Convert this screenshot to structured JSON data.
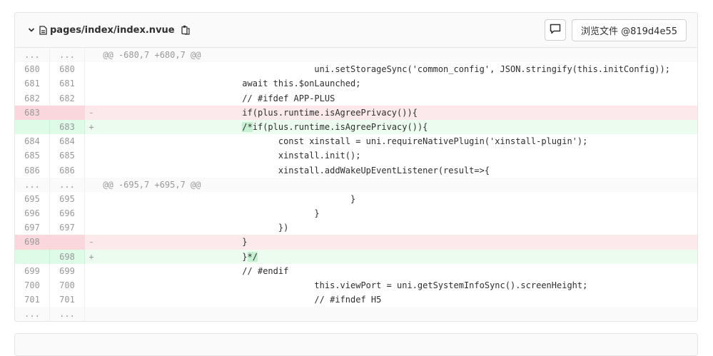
{
  "file": {
    "path": "pages/index/index.nvue",
    "view_file_label": "浏览文件 @819d4e55"
  },
  "lines": [
    {
      "type": "match",
      "old": "...",
      "new": "...",
      "sign": "",
      "code": "@@ -680,7 +680,7 @@"
    },
    {
      "type": "context",
      "old": "680",
      "new": "680",
      "sign": "",
      "code": "\t\t\t\t\t\tuni.setStorageSync('common_config', JSON.stringify(this.initConfig));"
    },
    {
      "type": "context",
      "old": "681",
      "new": "681",
      "sign": "",
      "code": "\t\t\t\tawait this.$onLaunched;"
    },
    {
      "type": "context",
      "old": "682",
      "new": "682",
      "sign": "",
      "code": "\t\t\t\t// #ifdef APP-PLUS"
    },
    {
      "type": "old",
      "old": "683",
      "new": "",
      "sign": "-",
      "code": "\t\t\t\tif(plus.runtime.isAgreePrivacy()){"
    },
    {
      "type": "new",
      "old": "",
      "new": "683",
      "sign": "+",
      "code_hl": "/*",
      "code_rest": "if(plus.runtime.isAgreePrivacy()){",
      "code": "\t\t\t\t"
    },
    {
      "type": "context",
      "old": "684",
      "new": "684",
      "sign": "",
      "code": "\t\t\t\t\tconst xinstall = uni.requireNativePlugin('xinstall-plugin');"
    },
    {
      "type": "context",
      "old": "685",
      "new": "685",
      "sign": "",
      "code": "\t\t\t\t\txinstall.init();"
    },
    {
      "type": "context",
      "old": "686",
      "new": "686",
      "sign": "",
      "code": "\t\t\t\t\txinstall.addWakeUpEventListener(result=>{"
    },
    {
      "type": "match",
      "old": "...",
      "new": "...",
      "sign": "",
      "code": "@@ -695,7 +695,7 @@"
    },
    {
      "type": "context",
      "old": "695",
      "new": "695",
      "sign": "",
      "code": "\t\t\t\t\t\t\t}"
    },
    {
      "type": "context",
      "old": "696",
      "new": "696",
      "sign": "",
      "code": "\t\t\t\t\t\t}"
    },
    {
      "type": "context",
      "old": "697",
      "new": "697",
      "sign": "",
      "code": "\t\t\t\t\t})"
    },
    {
      "type": "old",
      "old": "698",
      "new": "",
      "sign": "-",
      "code": "\t\t\t\t}"
    },
    {
      "type": "new",
      "old": "",
      "new": "698",
      "sign": "+",
      "code": "\t\t\t\t}",
      "code_hl": "*/",
      "code_rest": ""
    },
    {
      "type": "context",
      "old": "699",
      "new": "699",
      "sign": "",
      "code": "\t\t\t\t// #endif"
    },
    {
      "type": "context",
      "old": "700",
      "new": "700",
      "sign": "",
      "code": "\t\t\t\t\t\tthis.viewPort = uni.getSystemInfoSync().screenHeight;"
    },
    {
      "type": "context",
      "old": "701",
      "new": "701",
      "sign": "",
      "code": "\t\t\t\t\t\t// #ifndef H5"
    },
    {
      "type": "match",
      "old": "...",
      "new": "...",
      "sign": "",
      "code": ""
    }
  ]
}
